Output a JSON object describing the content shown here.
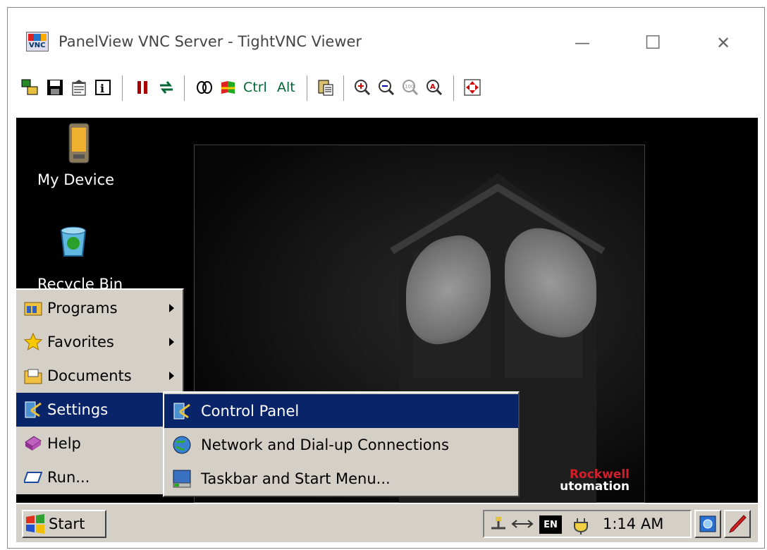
{
  "window": {
    "title": "PanelView VNC Server - TightVNC Viewer",
    "controls": {
      "minimize": "—",
      "maximize": "☐",
      "close": "✕"
    }
  },
  "toolbar": {
    "buttons": [
      {
        "name": "new-connection-icon"
      },
      {
        "name": "save-icon"
      },
      {
        "name": "options-icon"
      },
      {
        "name": "connection-info-icon"
      },
      {
        "name": "pause-icon"
      },
      {
        "name": "refresh-icon"
      },
      {
        "name": "transfer-files-icon"
      },
      {
        "name": "send-cad-icon"
      },
      {
        "name": "clipboard-icon"
      },
      {
        "name": "zoom-in-icon"
      },
      {
        "name": "zoom-out-icon"
      },
      {
        "name": "zoom-100-icon"
      },
      {
        "name": "zoom-auto-icon"
      },
      {
        "name": "fullscreen-icon"
      }
    ],
    "ctrl_label": "Ctrl",
    "alt_label": "Alt"
  },
  "desktop": {
    "icons": [
      {
        "label": "My Device",
        "icon": "pda-icon"
      },
      {
        "label": "Recycle Bin",
        "icon": "recycle-bin-icon"
      }
    ],
    "wallpaper_brand": {
      "line1": "Rockwell",
      "line2": "utomation"
    }
  },
  "start_menu": {
    "items": [
      {
        "label": "Programs",
        "icon": "programs-icon",
        "submenu": true
      },
      {
        "label": "Favorites",
        "icon": "favorites-icon",
        "submenu": true
      },
      {
        "label": "Documents",
        "icon": "documents-icon",
        "submenu": true
      },
      {
        "label": "Settings",
        "icon": "settings-icon",
        "submenu": true,
        "highlighted": true
      },
      {
        "label": "Help",
        "icon": "help-icon",
        "submenu": false
      },
      {
        "label": "Run...",
        "icon": "run-icon",
        "submenu": false
      }
    ]
  },
  "settings_submenu": {
    "items": [
      {
        "label": "Control Panel",
        "icon": "control-panel-icon",
        "highlighted": true
      },
      {
        "label": "Network and Dial-up Connections",
        "icon": "network-icon"
      },
      {
        "label": "Taskbar and Start Menu...",
        "icon": "taskbar-icon"
      }
    ]
  },
  "taskbar": {
    "start_label": "Start",
    "tray": {
      "language": "EN",
      "time": "1:14 AM"
    }
  },
  "colors": {
    "menu_bg": "#d4d0c8",
    "highlight": "#0a246a",
    "desktop_bg": "#000000",
    "brand_red": "#d41f2b"
  }
}
